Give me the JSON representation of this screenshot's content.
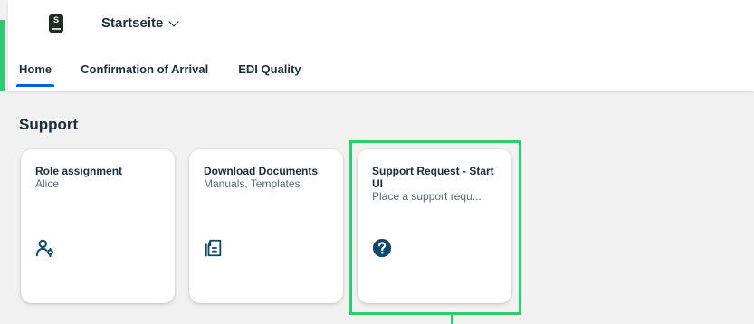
{
  "header": {
    "logo_icon": "brand-logo-icon",
    "logo_letter": "S",
    "app_title": "Startseite"
  },
  "tabs": [
    {
      "label": "Home",
      "active": true
    },
    {
      "label": "Confirmation of Arrival",
      "active": false
    },
    {
      "label": "EDI Quality",
      "active": false
    }
  ],
  "section": {
    "title": "Support"
  },
  "tiles": [
    {
      "title": "Role assignment",
      "subtitle": "Alice",
      "icon": "user-role-icon"
    },
    {
      "title": "Download Documents",
      "subtitle": "Manuals, Templates",
      "icon": "documents-icon"
    },
    {
      "title": "Support Request - Start UI",
      "subtitle": "Place a support requ...",
      "icon": "question-circle-icon"
    }
  ],
  "colors": {
    "accent_green": "#2ecc71",
    "tab_indicator": "#0064d9",
    "icon_color": "#0b4a6b",
    "text_primary": "#1d2d3e"
  }
}
